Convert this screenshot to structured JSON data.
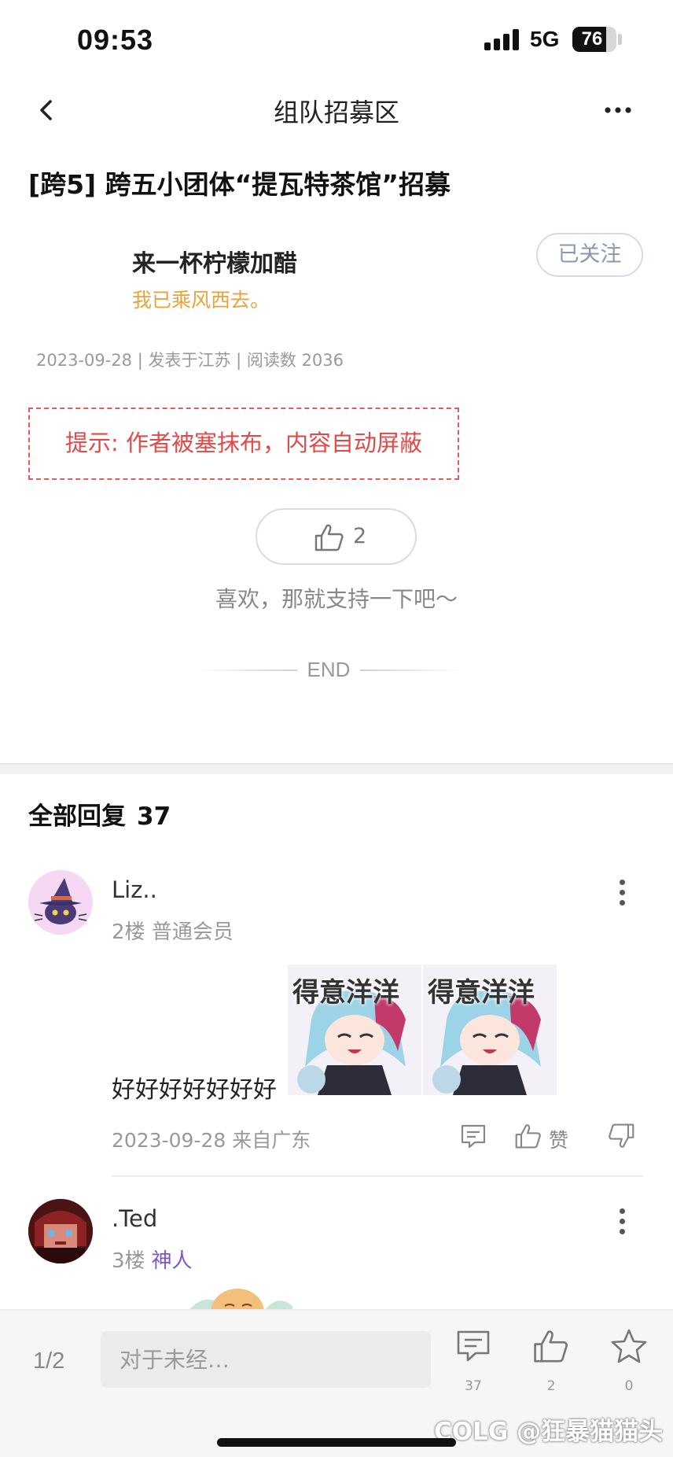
{
  "status_bar": {
    "time": "09:53",
    "network": "5G",
    "battery": "76",
    "battery_level": 0.76
  },
  "nav": {
    "title": "组队招募区",
    "back_icon": "chevron-left-icon",
    "more_icon": "more-horizontal-icon"
  },
  "post": {
    "title": "[跨5] 跨五小团体“提瓦特茶馆”招募",
    "author": {
      "name": "来一杯柠檬加醋",
      "signature": "我已乘风西去。"
    },
    "follow_label": "已关注",
    "meta": "2023-09-28 | 发表于江苏 | 阅读数 2036",
    "notice": "提示: 作者被塞抹布，内容自动屏蔽",
    "like_count": "2",
    "support_text": "喜欢，那就支持一下吧～",
    "end_label": "END",
    "accent_color": "#e8a33a",
    "notice_color": "#e24a4a"
  },
  "replies": {
    "title": "全部回复",
    "count": "37",
    "items": [
      {
        "name": "Liz..",
        "floor": "2楼",
        "role": "普通会员",
        "text": "好好好好好好好",
        "stickers": [
          "得意洋洋",
          "得意洋洋"
        ],
        "date": "2023-09-28 来自广东",
        "like_label": "赞"
      },
      {
        "name": ".Ted",
        "floor": "3楼",
        "role": "神人",
        "role_color": "#7e57c2"
      }
    ]
  },
  "bottom_bar": {
    "page_indicator": "1/2",
    "input_placeholder": "对于未经…",
    "comment_count": "37",
    "like_count": "2",
    "favorite_count": "0",
    "watermark": "COLG @狂暴猫猫头"
  }
}
